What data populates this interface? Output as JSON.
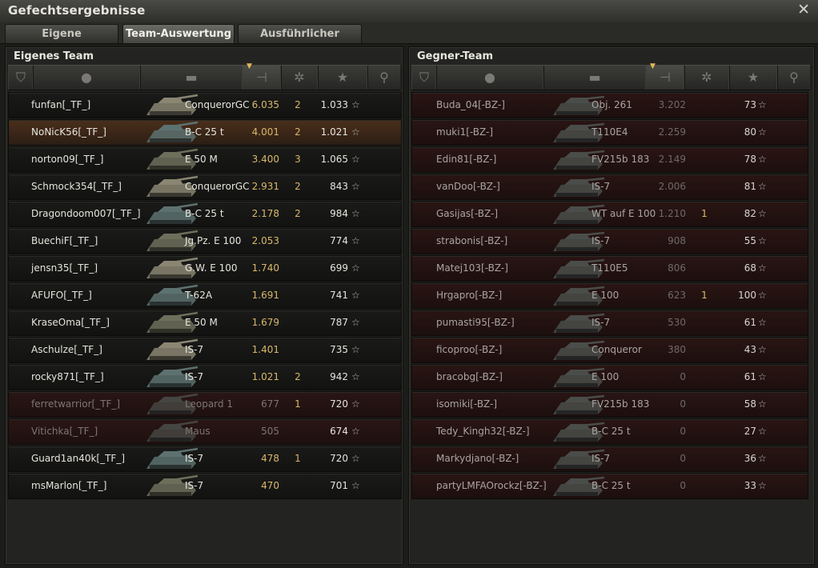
{
  "window": {
    "title": "Gefechtsergebnisse",
    "close_icon": "close-icon"
  },
  "tabs": [
    {
      "label": "Eigene Auswertung",
      "active": false
    },
    {
      "label": "Team-Auswertung",
      "active": true
    },
    {
      "label": "Ausführlicher Bericht",
      "active": false
    }
  ],
  "own_team": {
    "title": "Eigenes Team",
    "header_icons": [
      "platoon-icon",
      "player-icon",
      "tank-icon",
      "damage-icon",
      "kills-icon",
      "xp-star-icon",
      "medal-icon"
    ],
    "rows": [
      {
        "player": "funfan[_TF_]",
        "tank": "ConquerorGC",
        "damage": "6.035",
        "kills": "2",
        "xp": "1.033",
        "state": "alive"
      },
      {
        "player": "NoNicK56[_TF_]",
        "tank": "B-C 25 t",
        "damage": "4.001",
        "kills": "2",
        "xp": "1.021",
        "state": "me"
      },
      {
        "player": "norton09[_TF_]",
        "tank": "E 50 M",
        "damage": "3.400",
        "kills": "3",
        "xp": "1.065",
        "state": "alive"
      },
      {
        "player": "Schmock354[_TF_]",
        "tank": "ConquerorGC",
        "damage": "2.931",
        "kills": "2",
        "xp": "843",
        "state": "alive"
      },
      {
        "player": "Dragondoom007[_TF_]",
        "tank": "B-C 25 t",
        "damage": "2.178",
        "kills": "2",
        "xp": "984",
        "state": "alive"
      },
      {
        "player": "BuechiF[_TF_]",
        "tank": "Jg.Pz. E 100",
        "damage": "2.053",
        "kills": "",
        "xp": "774",
        "state": "alive"
      },
      {
        "player": "jensn35[_TF_]",
        "tank": "G.W. E 100",
        "damage": "1.740",
        "kills": "",
        "xp": "699",
        "state": "alive"
      },
      {
        "player": "AFUFO[_TF_]",
        "tank": "T-62A",
        "damage": "1.691",
        "kills": "",
        "xp": "741",
        "state": "alive"
      },
      {
        "player": "KraseOma[_TF_]",
        "tank": "E 50 M",
        "damage": "1.679",
        "kills": "",
        "xp": "787",
        "state": "alive"
      },
      {
        "player": "Aschulze[_TF_]",
        "tank": "IS-7",
        "damage": "1.401",
        "kills": "",
        "xp": "735",
        "state": "alive"
      },
      {
        "player": "rocky871[_TF_]",
        "tank": "IS-7",
        "damage": "1.021",
        "kills": "2",
        "xp": "942",
        "state": "alive"
      },
      {
        "player": "ferretwarrior[_TF_]",
        "tank": "Leopard 1",
        "damage": "677",
        "kills": "1",
        "xp": "720",
        "state": "dead"
      },
      {
        "player": "Vitichka[_TF_]",
        "tank": "Maus",
        "damage": "505",
        "kills": "",
        "xp": "674",
        "state": "dead"
      },
      {
        "player": "Guard1an40k[_TF_]",
        "tank": "IS-7",
        "damage": "478",
        "kills": "1",
        "xp": "720",
        "state": "alive"
      },
      {
        "player": "msMarlon[_TF_]",
        "tank": "IS-7",
        "damage": "470",
        "kills": "",
        "xp": "701",
        "state": "alive"
      }
    ]
  },
  "enemy_team": {
    "title": "Gegner-Team",
    "header_icons": [
      "platoon-icon",
      "player-icon",
      "tank-icon",
      "damage-icon",
      "kills-icon",
      "xp-star-icon",
      "medal-icon"
    ],
    "rows": [
      {
        "player": "Buda_04[-BZ-]",
        "tank": "Obj. 261",
        "damage": "3.202",
        "kills": "",
        "xp": "73"
      },
      {
        "player": "muki1[-BZ-]",
        "tank": "T110E4",
        "damage": "2.259",
        "kills": "",
        "xp": "80"
      },
      {
        "player": "Edin81[-BZ-]",
        "tank": "FV215b 183",
        "damage": "2.149",
        "kills": "",
        "xp": "78"
      },
      {
        "player": "vanDoo[-BZ-]",
        "tank": "IS-7",
        "damage": "2.006",
        "kills": "",
        "xp": "81"
      },
      {
        "player": "Gasijas[-BZ-]",
        "tank": "WT auf E 100",
        "damage": "1.210",
        "kills": "1",
        "xp": "82"
      },
      {
        "player": "strabonis[-BZ-]",
        "tank": "IS-7",
        "damage": "908",
        "kills": "",
        "xp": "55"
      },
      {
        "player": "Matej103[-BZ-]",
        "tank": "T110E5",
        "damage": "806",
        "kills": "",
        "xp": "68"
      },
      {
        "player": "Hrgapro[-BZ-]",
        "tank": "E 100",
        "damage": "623",
        "kills": "1",
        "xp": "100"
      },
      {
        "player": "pumasti95[-BZ-]",
        "tank": "IS-7",
        "damage": "530",
        "kills": "",
        "xp": "61"
      },
      {
        "player": "ficoproo[-BZ-]",
        "tank": "Conqueror",
        "damage": "380",
        "kills": "",
        "xp": "43"
      },
      {
        "player": "bracobg[-BZ-]",
        "tank": "E 100",
        "damage": "0",
        "kills": "",
        "xp": "61"
      },
      {
        "player": "isomiki[-BZ-]",
        "tank": "FV215b 183",
        "damage": "0",
        "kills": "",
        "xp": "58"
      },
      {
        "player": "Tedy_Kingh32[-BZ-]",
        "tank": "B-C 25 t",
        "damage": "0",
        "kills": "",
        "xp": "27"
      },
      {
        "player": "Markydjano[-BZ-]",
        "tank": "IS-7",
        "damage": "0",
        "kills": "",
        "xp": "36"
      },
      {
        "player": "partyLMFAOrockz[-BZ-]",
        "tank": "B-C 25 t",
        "damage": "0",
        "kills": "",
        "xp": "33"
      }
    ]
  },
  "colors": {
    "accent_gold": "#d9b86a",
    "own_row": "#121211",
    "enemy_row": "#2a1513",
    "me_row": "#4a2f1c"
  }
}
